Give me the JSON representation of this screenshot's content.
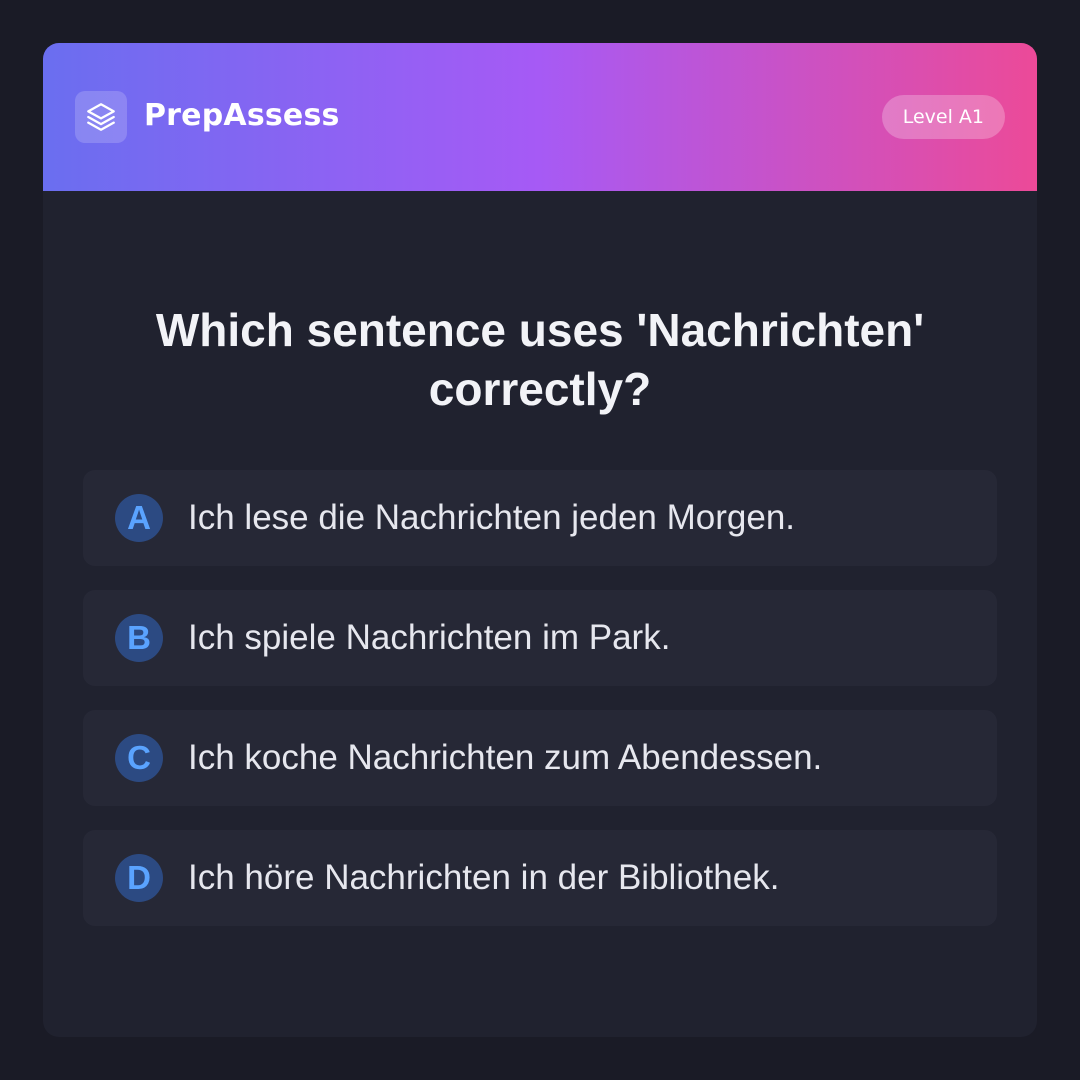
{
  "header": {
    "brand": "PrepAssess",
    "logo_icon": "layers-icon",
    "level": "Level A1"
  },
  "question": "Which sentence uses 'Nachrichten' correctly?",
  "options": [
    {
      "letter": "A",
      "text": "Ich lese die Nachrichten jeden Morgen."
    },
    {
      "letter": "B",
      "text": "Ich spiele Nachrichten im Park."
    },
    {
      "letter": "C",
      "text": "Ich koche Nachrichten zum Abendessen."
    },
    {
      "letter": "D",
      "text": "Ich höre Nachrichten in der Bibliothek."
    }
  ],
  "colors": {
    "background": "#1a1b26",
    "card": "#20222f",
    "option_bg": "#262836",
    "accent_blue": "#5aa3ff",
    "gradient_start": "#6a6ef0",
    "gradient_mid": "#a65af5",
    "gradient_end": "#ec4a98"
  }
}
